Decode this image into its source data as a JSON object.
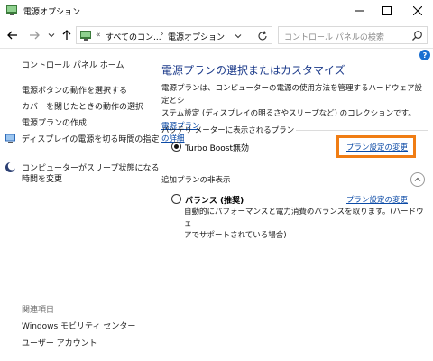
{
  "window": {
    "title": "電源オプション",
    "icon": "power-options-icon"
  },
  "navigation": {
    "breadcrumb_overflow": "«",
    "breadcrumb_1": "すべてのコン...",
    "separator": "›",
    "breadcrumb_2": "電源オプション",
    "search_placeholder": "コントロール パネルの検索"
  },
  "sidebar": {
    "home_link": "コントロール パネル ホーム",
    "items": [
      "電源ボタンの動作を選択する",
      "カバーを閉じたときの動作の選択",
      "電源プランの作成",
      "ディスプレイの電源を切る時間の指定",
      "コンピューターがスリープ状態になる",
      "時間を変更"
    ],
    "related_heading": "関連項目",
    "related_items": [
      "Windows モビリティ センター",
      "ユーザー アカウント"
    ]
  },
  "main": {
    "help": "?",
    "heading": "電源プランの選択またはカスタマイズ",
    "description_lines": [
      "電源プランは、コンピューターの電源の使用方法を管理するハードウェア設定とシ",
      "ステム設定 (ディスプレイの明るさやスリープなど) のコレクションです。"
    ],
    "description_link_1": "電源プラン",
    "description_link_2": "の詳細",
    "battery_section_title": "バッテリ メーターに表示されるプラン",
    "active_plan": {
      "name": "Turbo Boost無効",
      "change_link": "プラン設定の変更",
      "selected": true
    },
    "additional_section_title": "追加プランの非表示",
    "additional_plan": {
      "name": "バランス (推奨)",
      "change_link": "プラン設定の変更",
      "selected": false,
      "description_lines": [
        "自動的にパフォーマンスと電力消費のバランスを取ります。(ハードウェ",
        "アでサポートされている場合)"
      ]
    }
  },
  "colors": {
    "link": "#0b4aa6",
    "heading": "#1b3a8a",
    "highlight": "#f07d14",
    "help": "#1a6fd1"
  }
}
